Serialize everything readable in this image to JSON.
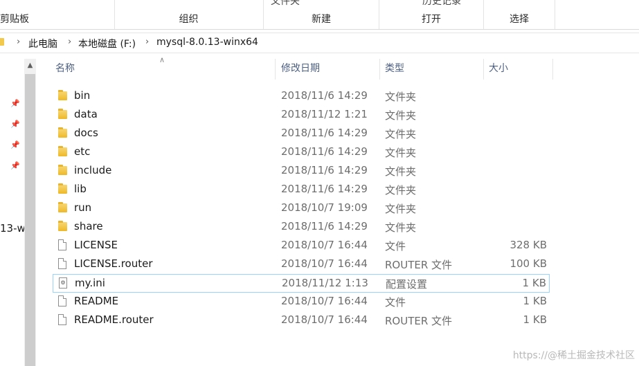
{
  "ribbon": {
    "groups": [
      {
        "label": "剪贴板",
        "top": ""
      },
      {
        "label": "组织",
        "top": ""
      },
      {
        "label": "新建",
        "top": "文件夹"
      },
      {
        "label": "打开",
        "top": "历史记录"
      },
      {
        "label": "选择",
        "top": ""
      }
    ]
  },
  "address": {
    "crumbs": [
      "此电脑",
      "本地磁盘 (F:)",
      "mysql-8.0.13-winx64"
    ]
  },
  "nav": {
    "truncated_item": "13-w"
  },
  "columns": {
    "name": "名称",
    "date": "修改日期",
    "type": "类型",
    "size": "大小"
  },
  "rows": [
    {
      "name": "bin",
      "date": "2018/11/6 14:29",
      "type": "文件夹",
      "size": "",
      "icon": "folder-icon"
    },
    {
      "name": "data",
      "date": "2018/11/12 1:21",
      "type": "文件夹",
      "size": "",
      "icon": "folder-icon"
    },
    {
      "name": "docs",
      "date": "2018/11/6 14:29",
      "type": "文件夹",
      "size": "",
      "icon": "folder-icon"
    },
    {
      "name": "etc",
      "date": "2018/11/6 14:29",
      "type": "文件夹",
      "size": "",
      "icon": "folder-icon"
    },
    {
      "name": "include",
      "date": "2018/11/6 14:29",
      "type": "文件夹",
      "size": "",
      "icon": "folder-icon"
    },
    {
      "name": "lib",
      "date": "2018/11/6 14:29",
      "type": "文件夹",
      "size": "",
      "icon": "folder-icon"
    },
    {
      "name": "run",
      "date": "2018/10/7 19:09",
      "type": "文件夹",
      "size": "",
      "icon": "folder-icon"
    },
    {
      "name": "share",
      "date": "2018/11/6 14:29",
      "type": "文件夹",
      "size": "",
      "icon": "folder-icon"
    },
    {
      "name": "LICENSE",
      "date": "2018/10/7 16:44",
      "type": "文件",
      "size": "328 KB",
      "icon": "file-icon"
    },
    {
      "name": "LICENSE.router",
      "date": "2018/10/7 16:44",
      "type": "ROUTER 文件",
      "size": "100 KB",
      "icon": "file-icon"
    },
    {
      "name": "my.ini",
      "date": "2018/11/12 1:13",
      "type": "配置设置",
      "size": "1 KB",
      "icon": "settings-file-icon",
      "selected": true
    },
    {
      "name": "README",
      "date": "2018/10/7 16:44",
      "type": "文件",
      "size": "1 KB",
      "icon": "file-icon"
    },
    {
      "name": "README.router",
      "date": "2018/10/7 16:44",
      "type": "ROUTER 文件",
      "size": "1 KB",
      "icon": "file-icon"
    }
  ],
  "watermark": "https://@稀土掘金技术社区"
}
